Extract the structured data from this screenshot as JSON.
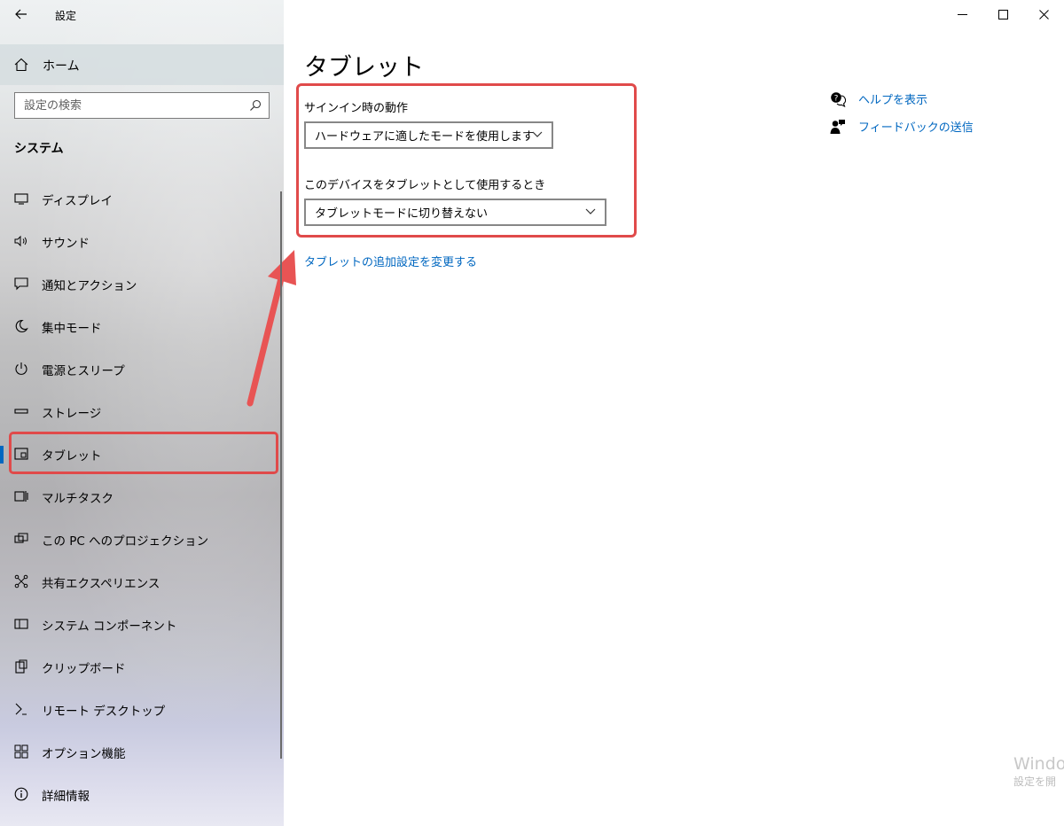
{
  "app": {
    "title": "設定"
  },
  "window_controls": {
    "minimize": "—",
    "maximize": "☐",
    "close": "✕"
  },
  "sidebar": {
    "home_label": "ホーム",
    "search_placeholder": "設定の検索",
    "section_label": "システム",
    "items": [
      {
        "label": "ディスプレイ",
        "icon": "display-icon"
      },
      {
        "label": "サウンド",
        "icon": "speaker-icon"
      },
      {
        "label": "通知とアクション",
        "icon": "notification-icon"
      },
      {
        "label": "集中モード",
        "icon": "moon-icon"
      },
      {
        "label": "電源とスリープ",
        "icon": "power-icon"
      },
      {
        "label": "ストレージ",
        "icon": "storage-icon"
      },
      {
        "label": "タブレット",
        "icon": "tablet-icon",
        "active": true
      },
      {
        "label": "マルチタスク",
        "icon": "multitask-icon"
      },
      {
        "label": "この PC へのプロジェクション",
        "icon": "projection-icon"
      },
      {
        "label": "共有エクスペリエンス",
        "icon": "shared-icon"
      },
      {
        "label": "システム コンポーネント",
        "icon": "component-icon"
      },
      {
        "label": "クリップボード",
        "icon": "clipboard-icon"
      },
      {
        "label": "リモート デスクトップ",
        "icon": "remote-icon"
      },
      {
        "label": "オプション機能",
        "icon": "optional-features-icon"
      },
      {
        "label": "詳細情報",
        "icon": "info-icon"
      }
    ]
  },
  "main": {
    "title": "タブレット",
    "signin_label": "サインイン時の動作",
    "signin_value": "ハードウェアに適したモードを使用します",
    "tablet_use_label": "このデバイスをタブレットとして使用するとき",
    "tablet_use_value": "タブレットモードに切り替えない",
    "additional_link": "タブレットの追加設定を変更する"
  },
  "help": {
    "show_help": "ヘルプを表示",
    "feedback": "フィードバックの送信"
  },
  "watermark": {
    "line1": "Windo",
    "line2": "設定を開"
  },
  "colors": {
    "accent": "#0067c0",
    "highlight": "#e04a4a"
  }
}
